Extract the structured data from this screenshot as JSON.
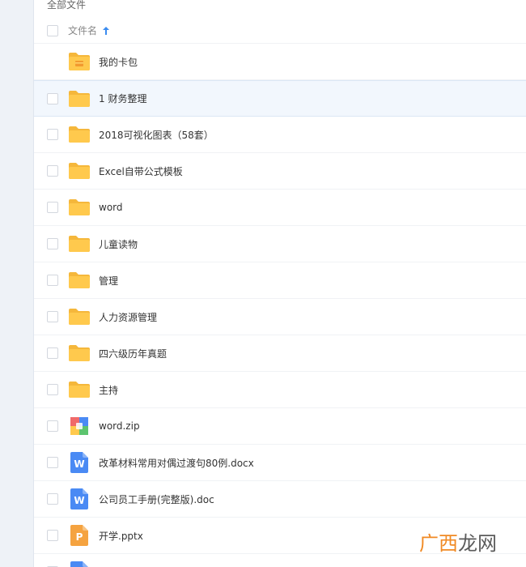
{
  "breadcrumb": "全部文件",
  "header": {
    "name_label": "文件名"
  },
  "files": [
    {
      "name": "我的卡包",
      "type": "cardbag",
      "selected": false,
      "checkbox": false
    },
    {
      "name": "1 财务整理",
      "type": "folder",
      "selected": true,
      "checkbox": true
    },
    {
      "name": "2018可视化图表（58套）",
      "type": "folder",
      "selected": false,
      "checkbox": true
    },
    {
      "name": "Excel自带公式模板",
      "type": "folder",
      "selected": false,
      "checkbox": true
    },
    {
      "name": "word",
      "type": "folder",
      "selected": false,
      "checkbox": true
    },
    {
      "name": "儿童读物",
      "type": "folder",
      "selected": false,
      "checkbox": true
    },
    {
      "name": "管理",
      "type": "folder",
      "selected": false,
      "checkbox": true
    },
    {
      "name": "人力资源管理",
      "type": "folder",
      "selected": false,
      "checkbox": true
    },
    {
      "name": "四六级历年真题",
      "type": "folder",
      "selected": false,
      "checkbox": true
    },
    {
      "name": "主持",
      "type": "folder",
      "selected": false,
      "checkbox": true
    },
    {
      "name": "word.zip",
      "type": "zip",
      "selected": false,
      "checkbox": true
    },
    {
      "name": "改革材料常用对偶过渡句80例.docx",
      "type": "word",
      "selected": false,
      "checkbox": true
    },
    {
      "name": "公司员工手册(完整版).doc",
      "type": "word",
      "selected": false,
      "checkbox": true
    },
    {
      "name": "开学.pptx",
      "type": "ppt",
      "selected": false,
      "checkbox": true
    },
    {
      "name": "",
      "type": "word",
      "selected": false,
      "checkbox": true
    }
  ],
  "icon_letters": {
    "word": "W",
    "ppt": "P"
  },
  "watermark": {
    "part1": "广西",
    "part2": "龙网"
  },
  "colors": {
    "folder": "#ffc94d",
    "folder_tab": "#f5b73b",
    "word": "#4a8af4",
    "ppt": "#f5a340",
    "accent": "#3b8cf0"
  }
}
